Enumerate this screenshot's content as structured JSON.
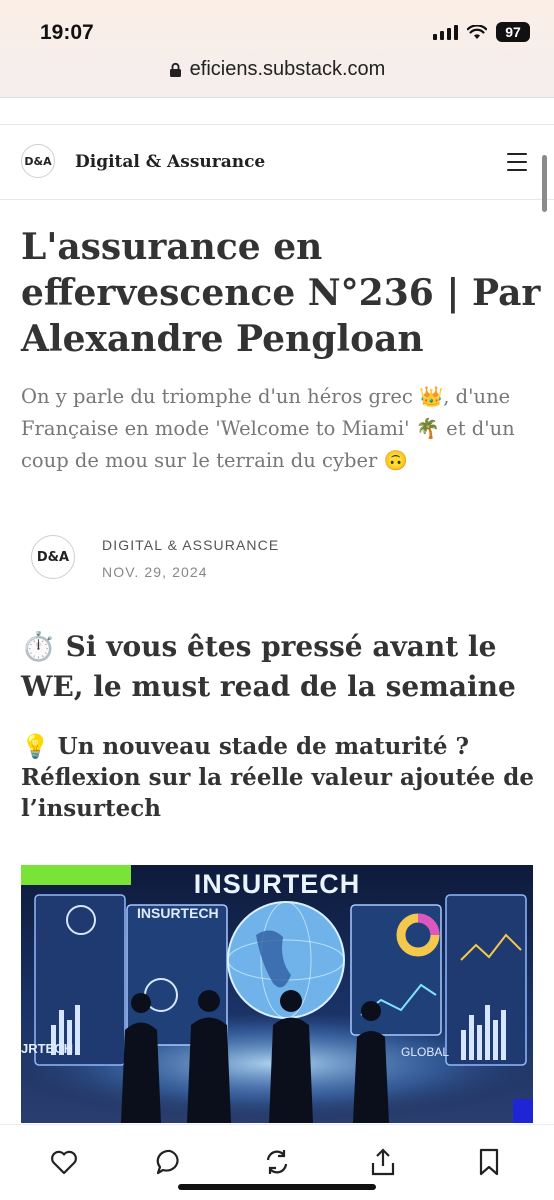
{
  "status_bar": {
    "time": "19:07",
    "battery": "97"
  },
  "browser": {
    "url": "eficiens.substack.com"
  },
  "publication": {
    "logo_text": "D&A",
    "name": "Digital & Assurance"
  },
  "article": {
    "title": "L'assurance en effervescence N°236 | Par Alexandre Pengloan",
    "subtitle": "On y parle du triomphe d'un héros grec 👑, d'une Française en mode 'Welcome to Miami' 🌴 et d'un coup de mou sur le terrain du cyber 🙃",
    "author": "DIGITAL & ASSURANCE",
    "date": "NOV. 29, 2024",
    "section_heading": "⏱️ Si vous êtes pressé avant le WE, le must read de la semaine",
    "sub_heading": "💡 Un nouveau stade de maturité ? Réflexion sur la réelle valeur ajoutée de l’insurtech"
  },
  "hero_image": {
    "title": "INSURTECH",
    "panel_left": "INSURTECH",
    "side_label": "JRTECH",
    "panel_right": "GLOBAL"
  },
  "bottom_actions": [
    "like-icon",
    "comment-icon",
    "restack-icon",
    "share-icon",
    "bookmark-icon"
  ]
}
